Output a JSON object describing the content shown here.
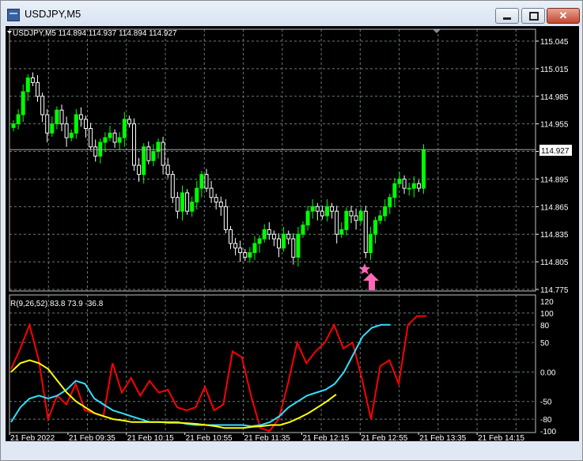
{
  "window": {
    "title": "USDJPY,M5",
    "minimize_icon": "minimize-icon",
    "maximize_icon": "maximize-icon",
    "close_icon": "close-icon"
  },
  "main_panel": {
    "header": "USDJPY,M5  114.894 114.937 114.894 114.927",
    "current_price": "114.927",
    "price_line": 114.927,
    "price_ticks": [
      "115.045",
      "115.015",
      "114.985",
      "114.955",
      "114.925",
      "114.895",
      "114.865",
      "114.835",
      "114.805",
      "114.775"
    ],
    "price_range": [
      114.775,
      115.045
    ],
    "signal_icons": [
      "star-icon",
      "up-arrow-icon"
    ],
    "colors": {
      "bull": "#00ff00",
      "bear": "#ffffff",
      "background": "#000000",
      "grid": "#6a7a7a",
      "signal": "#ff69b4"
    }
  },
  "sub_panel": {
    "header": "R(9,26,52) 83.8 73.9 -36.8",
    "ticks": [
      "120",
      "100",
      "80",
      "50",
      "0.00",
      "-50",
      "-80",
      "-100"
    ],
    "range": [
      -100,
      120
    ]
  },
  "time_axis": [
    "21 Feb 2022",
    "21 Feb 09:35",
    "21 Feb 10:15",
    "21 Feb 10:55",
    "21 Feb 11:35",
    "21 Feb 12:15",
    "21 Feb 12:55",
    "21 Feb 13:35",
    "21 Feb 14:15"
  ],
  "chart_data": [
    {
      "type": "candlestick",
      "title": "USDJPY,M5",
      "ylim": [
        114.775,
        115.045
      ],
      "candles_close": [
        114.955,
        114.965,
        114.99,
        115.005,
        115.0,
        114.985,
        114.965,
        114.945,
        114.955,
        114.97,
        114.955,
        114.94,
        114.945,
        114.965,
        114.96,
        114.95,
        114.93,
        114.92,
        114.935,
        114.94,
        114.945,
        114.935,
        114.94,
        114.96,
        114.955,
        114.91,
        114.9,
        114.93,
        114.915,
        114.925,
        114.935,
        114.91,
        114.9,
        114.875,
        114.86,
        114.88,
        114.86,
        114.87,
        114.885,
        114.9,
        114.885,
        114.875,
        114.87,
        114.865,
        114.84,
        114.825,
        114.82,
        114.815,
        114.81,
        114.815,
        114.825,
        114.83,
        114.84,
        114.835,
        114.83,
        114.82,
        114.835,
        114.83,
        114.81,
        114.835,
        114.845,
        114.86,
        114.865,
        114.86,
        114.855,
        114.865,
        114.86,
        114.835,
        114.84,
        114.86,
        114.855,
        114.85,
        114.86,
        114.815,
        114.835,
        114.85,
        114.855,
        114.865,
        114.875,
        114.89,
        114.895,
        114.885,
        114.885,
        114.89,
        114.885,
        114.927
      ]
    },
    {
      "type": "line",
      "title": "R(9,26,52)",
      "ylim": [
        -100,
        120
      ],
      "series": [
        {
          "name": "",
          "color": "#ff0000",
          "values": [
            5,
            40,
            80,
            20,
            -80,
            -40,
            -55,
            -20,
            -65,
            -70,
            -75,
            15,
            -35,
            -10,
            -40,
            -15,
            -35,
            -30,
            -60,
            -65,
            -60,
            -25,
            -65,
            -55,
            35,
            25,
            -40,
            -95,
            -100,
            -80,
            -20,
            50,
            15,
            35,
            50,
            80,
            40,
            50,
            -10,
            -80,
            10,
            20,
            -20,
            80,
            95,
            95
          ]
        },
        {
          "name": "",
          "color": "#33dfff",
          "values": [
            -85,
            -60,
            -45,
            -40,
            -45,
            -40,
            -30,
            -15,
            -20,
            -45,
            -55,
            -65,
            -70,
            -75,
            -80,
            -85,
            -85,
            -85,
            -85,
            -88,
            -90,
            -90,
            -90,
            -90,
            -90,
            -90,
            -92,
            -90,
            -85,
            -75,
            -60,
            -50,
            -40,
            -35,
            -30,
            -20,
            0,
            30,
            60,
            75,
            80,
            80
          ]
        },
        {
          "name": "",
          "color": "#ffff00",
          "values": [
            0,
            15,
            20,
            15,
            5,
            -15,
            -35,
            -50,
            -60,
            -70,
            -75,
            -80,
            -82,
            -85,
            -85,
            -85,
            -85,
            -86,
            -86,
            -87,
            -88,
            -90,
            -92,
            -95,
            -95,
            -95,
            -93,
            -92,
            -90,
            -90,
            -85,
            -78,
            -70,
            -60,
            -50,
            -38
          ]
        }
      ]
    }
  ]
}
